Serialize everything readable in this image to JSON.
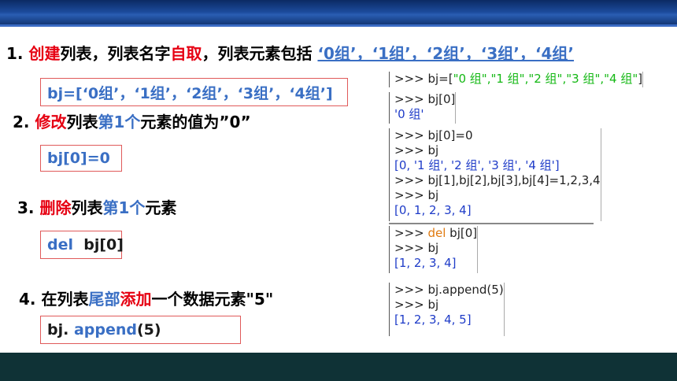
{
  "slide": {
    "step1": {
      "num": "1. ",
      "hl1": "创建",
      "t1": "列表，列表名字",
      "hl2": "自取",
      "t2": "，列表元素包括 ",
      "elements": "‘0组’，‘1组’，‘2组’，‘3组’，‘4组’",
      "code": "bj=[‘0组’，‘1组’，‘2组’，‘3组’，‘4组’]"
    },
    "step2": {
      "num": "2. ",
      "hl1": "修改",
      "t1": "列表",
      "hl2": "第1个",
      "t2": "元素的值为”0”",
      "code": "bj[0]=0"
    },
    "step3": {
      "num": "3. ",
      "hl1": "删除",
      "t1": "列表",
      "hl2": "第1个",
      "t2": "元素",
      "code_kw": "del",
      "code_rest": "  bj[0]"
    },
    "step4": {
      "num": "4. ",
      "t0": "在列表",
      "hl1": "尾部",
      "hl2": "添加",
      "t1": "一个数据元素\"5\"",
      "code_a": "bj. ",
      "code_kw": "append",
      "code_b": "(5)"
    }
  },
  "console": {
    "b1": {
      "prompt": ">>> bj=[",
      "strs": "\"0 组\",\"1 组\",\"2 组\",\"3 组\",\"4 组\"",
      "close": "]"
    },
    "b2": {
      "l1": ">>> bj[0]",
      "l2": "'0 组'"
    },
    "b3": {
      "l1": ">>> bj[0]=0",
      "l2": ">>> bj",
      "l3": "[0, '1 组', '2 组', '3 组', '4 组']",
      "l4": ">>> bj[1],bj[2],bj[3],bj[4]=1,2,3,4",
      "l5": ">>> bj",
      "l6": "[0, 1, 2, 3, 4]"
    },
    "b4": {
      "prompt": ">>> ",
      "kw": "del",
      "rest": " bj[0]",
      "l2": ">>> bj",
      "l3": "[1, 2, 3, 4]"
    },
    "b5": {
      "l1": ">>> bj.append(5)",
      "l2": ">>> bj",
      "l3": "[1, 2, 3, 4, 5]"
    }
  }
}
